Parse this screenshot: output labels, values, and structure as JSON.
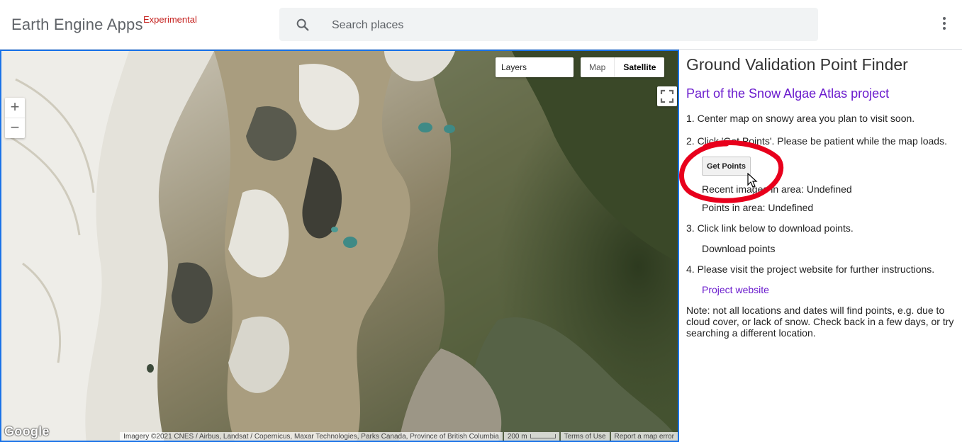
{
  "header": {
    "brand": "Earth Engine Apps",
    "badge": "Experimental",
    "search_placeholder": "Search places",
    "search_icon": "search-icon",
    "menu_icon": "more-vert-icon"
  },
  "map": {
    "layers_label": "Layers",
    "map_type_map": "Map",
    "map_type_satellite": "Satellite",
    "zoom_in": "+",
    "zoom_out": "−",
    "google_logo": "Google",
    "attribution": "Imagery ©2021 CNES / Airbus, Landsat / Copernicus, Maxar Technologies, Parks Canada, Province of British Columbia",
    "scale": "200 m",
    "terms": "Terms of Use",
    "report": "Report a map error"
  },
  "panel": {
    "title": "Ground Validation Point Finder",
    "subtitle": "Part of the Snow Algae Atlas project",
    "step1": "1. Center map on snowy area you plan to visit soon.",
    "step2": "2. Click 'Get Points'. Please be patient while the map loads.",
    "get_points_button": "Get Points",
    "recent_images": "Recent images in area: Undefined",
    "points_in_area": "Points in area: Undefined",
    "step3": "3. Click link below to download points.",
    "download_points": "Download points",
    "step4": "4. Please visit the project website for further instructions.",
    "project_website": "Project website",
    "note": "Note: not all locations and dates will find points, e.g. due to cloud cover, or lack of snow. Check back in a few days, or try searching a different location."
  },
  "colors": {
    "accent_link": "#6a1bcd",
    "map_border": "#1a73e8",
    "annotation_circle": "#e8001c",
    "badge": "#c5221f"
  }
}
